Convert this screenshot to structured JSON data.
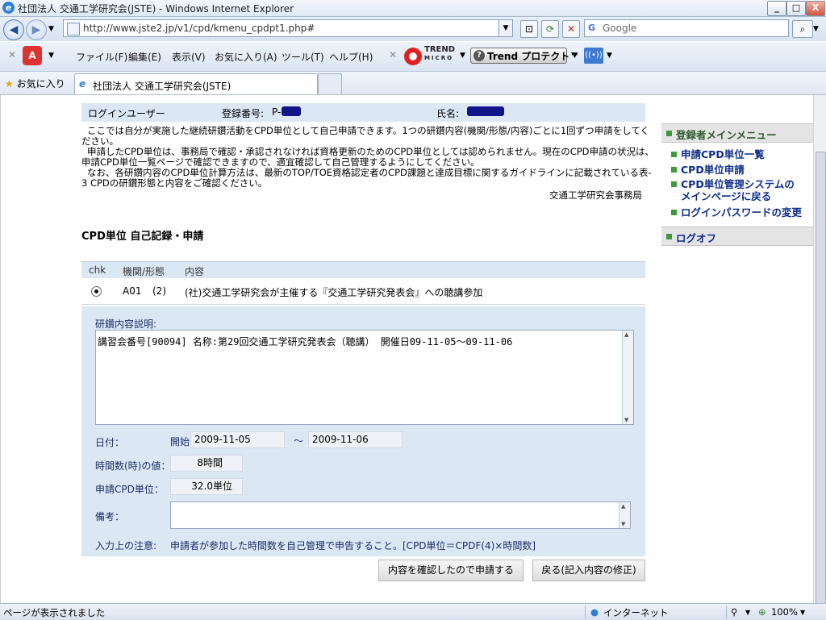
{
  "window": {
    "title": "社団法人 交通工学研究会(JSTE) - Windows Internet Explorer",
    "min": "_",
    "max": "□",
    "close": "X"
  },
  "addressbar": {
    "url": "http://www.jste2.jp/v1/cpd/kmenu_cpdpt1.php#",
    "search_placeholder": "Google"
  },
  "menu": {
    "file": "ファイル(F)",
    "edit": "編集(E)",
    "view": "表示(V)",
    "favorites": "お気に入り(A)",
    "tools": "ツール(T)",
    "help": "ヘルプ(H)",
    "trend_logo_top": "TREND",
    "trend_logo_bottom": "MICRO",
    "trend_protect": "Trend プロテクト™"
  },
  "favbar": {
    "favorites_label": "お気に入り",
    "tab_title": "社団法人 交通工学研究会(JSTE)"
  },
  "userbar": {
    "login_user": "ログインユーザー",
    "reg_no_label": "登録番号:",
    "reg_no_prefix": "P-",
    "name_label": "氏名:"
  },
  "intro": {
    "line1": "ここでは自分が実施した継続研鑽活動をCPD単位として自己申請できます。1つの研鑽内容(機関/形態/内容)ごとに1回ずつ申請をしてく",
    "line2": "ださい。",
    "line3": "申請したCPD単位は、事務局で確認・承認されなければ資格更新のためのCPD単位としては認められません。現在のCPD申請の状況は、",
    "line4": "申請CPD単位一覧ページで確認できますので、適宜確認して自己管理するようにしてください。",
    "line5": "なお、各研鑽内容のCPD単位計算方法は、最新のTOP/TOE資格認定者のCPD課題と達成目標に関するガイドラインに記載されている表-",
    "line6": "3 CPDの研鑽形態と内容をご確認ください。",
    "office": "交通工学研究会事務局"
  },
  "section": {
    "title": "CPD単位 自己記録・申請"
  },
  "table": {
    "headers": {
      "chk": "chk",
      "org": "機関/形態",
      "content": "内容"
    },
    "row": {
      "org": "A01",
      "form": "(2)",
      "content": "(社)交通工学研究会が主催する『交通工学研究発表会』への聴講参加"
    }
  },
  "form": {
    "desc_label": "研鑽内容説明:",
    "desc_value": "講習会番号[90094] 名称:第29回交通工学研究発表会（聴講） 開催日09-11-05〜09-11-06",
    "date_label": "日付：",
    "start_label": "開始",
    "start_date": "2009-11-05",
    "tilde": "〜",
    "end_date": "2009-11-06",
    "hours_label": "時間数(時)の値：",
    "hours_value": "8",
    "hours_unit": "時間",
    "cpd_label": "申請CPD単位：",
    "cpd_value": "32.0",
    "cpd_unit": "単位",
    "notes_label": "備考：",
    "caution_label": "入力上の注意:",
    "caution_text": "申請者が参加した時間数を自己管理で申告すること。[CPD単位＝CPDF(4)×時間数]",
    "submit_button": "内容を確認したので申請する",
    "back_button": "戻る(記入内容の修正)"
  },
  "sidemenu": {
    "title": "登録者メインメニュー",
    "item1": "申請CPD単位一覧",
    "item2": "CPD単位申請",
    "item3_line1": "CPD単位管理システムの",
    "item3_line2": "メインページに戻る",
    "item4": "ログインパスワードの変更",
    "logoff": "ログオフ"
  },
  "statusbar": {
    "message": "ページが表示されました",
    "zone": "インターネット",
    "zoom": "100%"
  },
  "colors": {
    "panel": "#dce7f4",
    "link": "#0d2e8a",
    "menu_square": "#3c9a3c"
  }
}
